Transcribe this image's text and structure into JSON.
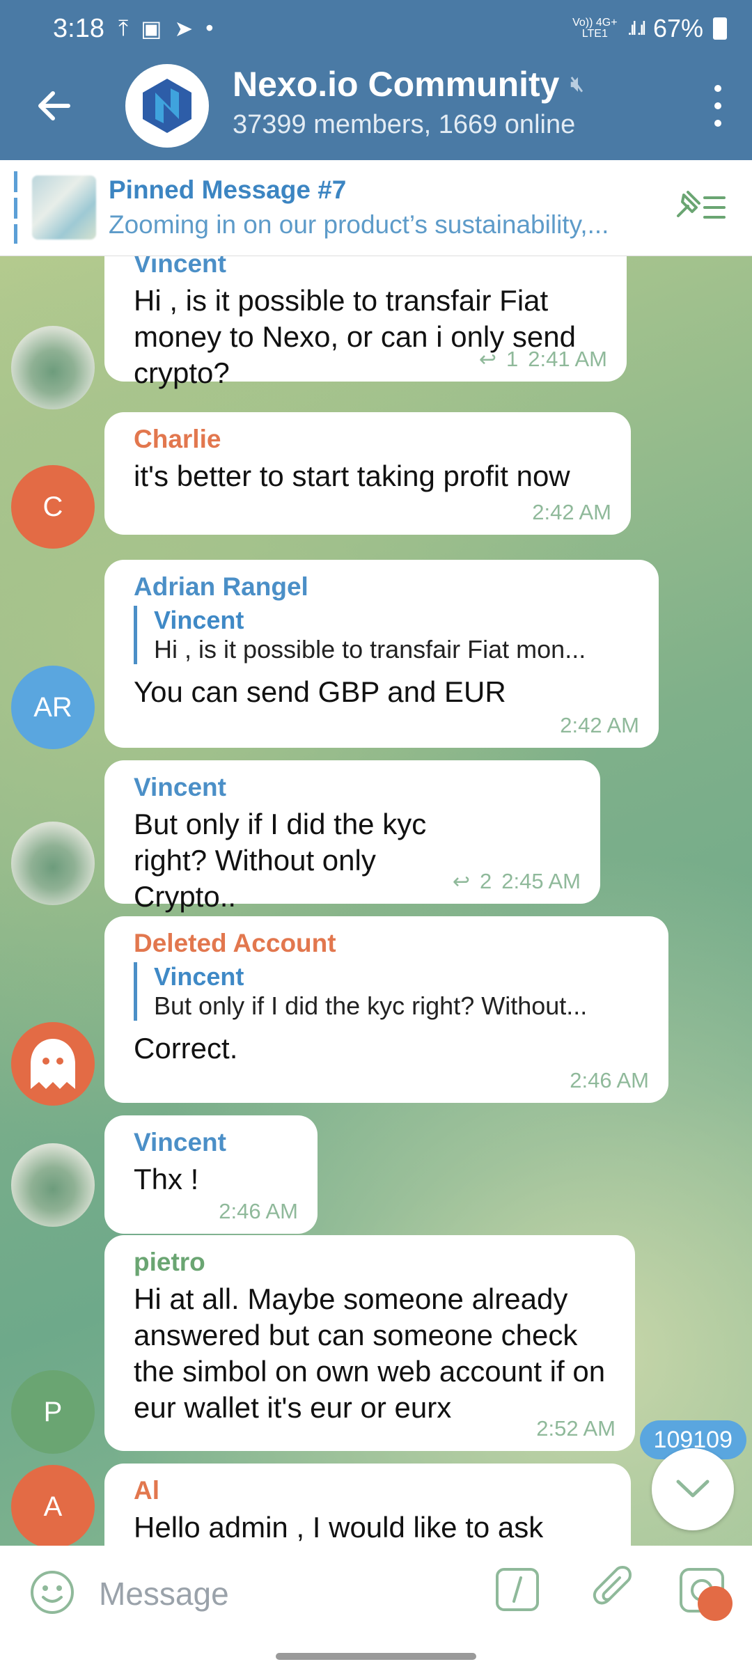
{
  "status": {
    "time": "3:18",
    "net_top": "Vo)) 4G+",
    "net_bottom": "LTE1",
    "battery": "67%"
  },
  "header": {
    "title": "Nexo.io Community",
    "subtitle": "37399 members, 1669 online"
  },
  "pinned": {
    "title": "Pinned Message #7",
    "text": "Zooming in on our product’s sustainability,..."
  },
  "messages": [
    {
      "sender": "Vincent",
      "text": "Hi , is it possible to transfair Fiat money to Nexo, or can i only send crypto?",
      "replies": "1",
      "time": "2:41 AM"
    },
    {
      "sender": "Charlie",
      "avatar": "C",
      "text": "it's better to start taking profit now",
      "time": "2:42 AM"
    },
    {
      "sender": "Adrian Rangel",
      "avatar": "AR",
      "quote_name": "Vincent",
      "quote_text": "Hi , is it possible to transfair Fiat mon...",
      "text": "You can send GBP and EUR",
      "time": "2:42 AM"
    },
    {
      "sender": "Vincent",
      "text": "But only if  I did the kyc  right? Without only Crypto..",
      "replies": "2",
      "time": "2:45 AM"
    },
    {
      "sender": "Deleted Account",
      "quote_name": "Vincent",
      "quote_text": "But only if  I did the kyc  right? Without...",
      "text": "Correct.",
      "time": "2:46 AM"
    },
    {
      "sender": "Vincent",
      "text": "Thx !",
      "time": "2:46 AM"
    },
    {
      "sender": "pietro",
      "avatar": "P",
      "text": "Hi at all. Maybe someone already answered but can someone check the simbol on own web account if on eur wallet it's eur or eurx",
      "time": "2:52 AM"
    },
    {
      "sender": "Al",
      "avatar": "A",
      "text": "Hello admin , I would like to ask"
    }
  ],
  "unread_count": "109109",
  "input": {
    "placeholder": "Message"
  },
  "colors": {
    "header": "#4a7aa5",
    "accent": "#4b8fc7",
    "orange": "#e2774e",
    "green": "#6aa572"
  },
  "icons": [
    "back-arrow-icon",
    "mute-icon",
    "more-vert-icon",
    "pin-list-icon",
    "reply-icon",
    "ghost-icon",
    "chevron-down-icon",
    "emoji-icon",
    "bot-command-icon",
    "attach-icon",
    "camera-icon"
  ]
}
